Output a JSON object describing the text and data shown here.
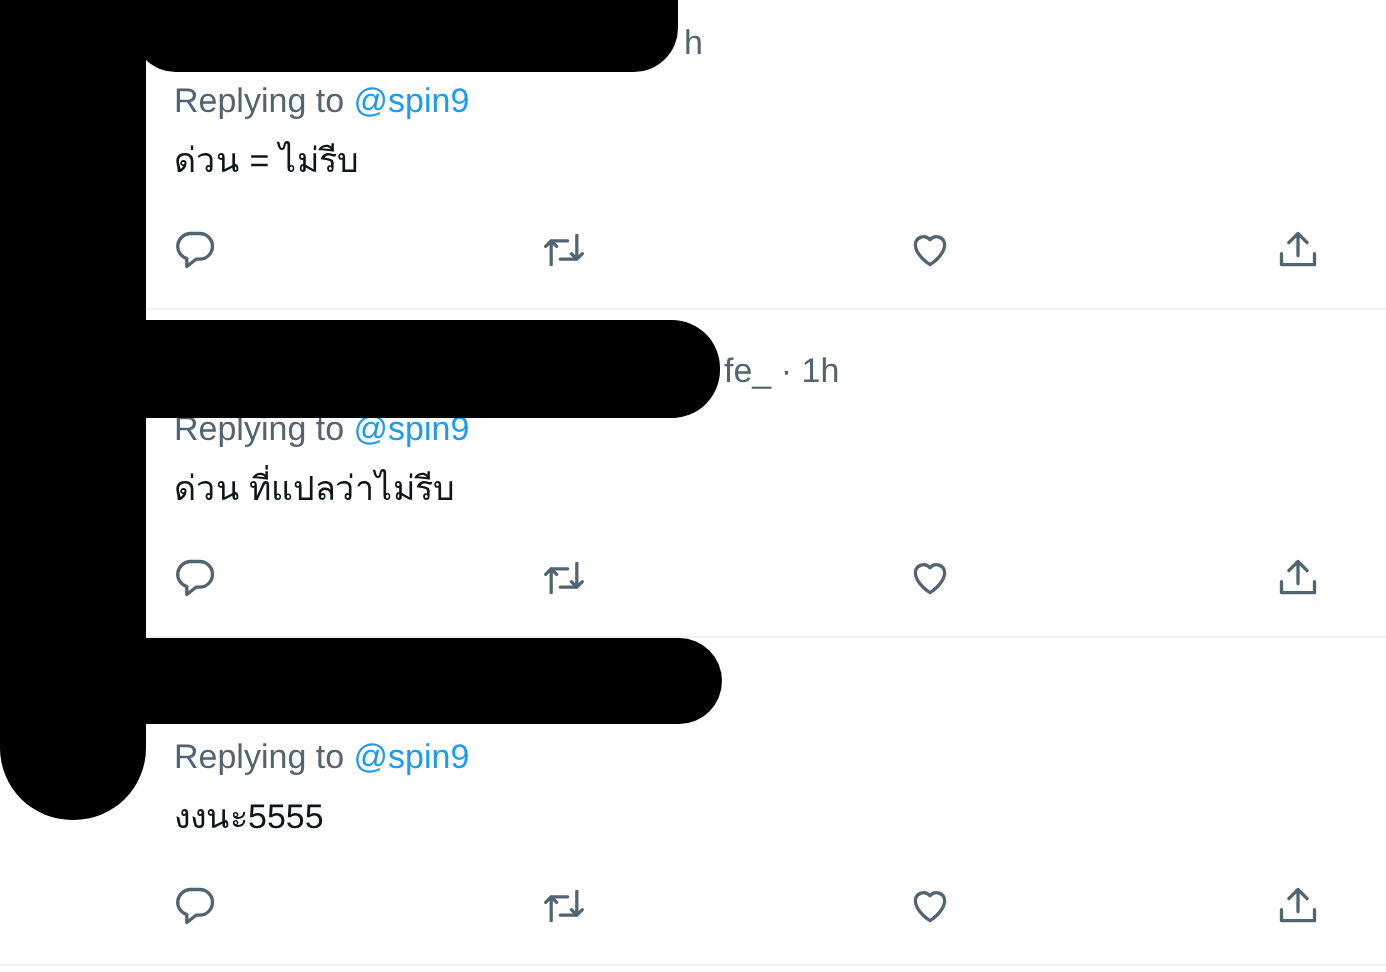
{
  "tweets": [
    {
      "header_fragment": "h",
      "replying_label": "Replying to",
      "replying_handle": "@spin9",
      "text": "ด่วน = ไม่รีบ"
    },
    {
      "header_fragment": "fe_ · 1h",
      "replying_label": "Replying to",
      "replying_handle": "@spin9",
      "text": "ด่วน ที่แปลว่าไม่รีบ"
    },
    {
      "replying_label": "Replying to",
      "replying_handle": "@spin9",
      "text": "งงนะ5555"
    }
  ]
}
